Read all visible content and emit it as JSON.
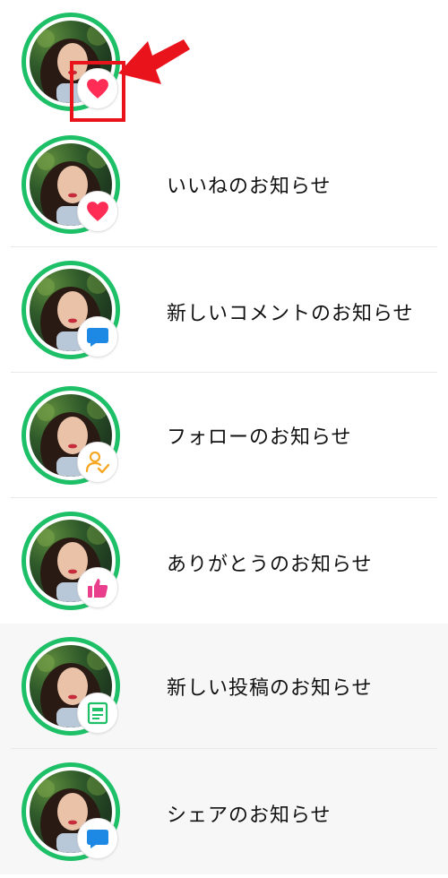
{
  "notifications": [
    {
      "label": "",
      "badge_icon": "heart-icon",
      "badge_color": "#ff2d55"
    },
    {
      "label": "いいねのお知らせ",
      "badge_icon": "heart-icon",
      "badge_color": "#ff2d55"
    },
    {
      "label": "新しいコメントのお知らせ",
      "badge_icon": "comment-icon",
      "badge_color": "#1e88e5"
    },
    {
      "label": "フォローのお知らせ",
      "badge_icon": "follow-icon",
      "badge_color": "#f5a623"
    },
    {
      "label": "ありがとうのお知らせ",
      "badge_icon": "thumbs-up-icon",
      "badge_color": "#e83e8c"
    },
    {
      "label": "新しい投稿のお知らせ",
      "badge_icon": "post-icon",
      "badge_color": "#1dbf67"
    },
    {
      "label": "シェアのお知らせ",
      "badge_icon": "share-icon",
      "badge_color": "#1e88e5"
    }
  ],
  "colors": {
    "ring": "#1dbf67",
    "callout": "#e8131b"
  }
}
